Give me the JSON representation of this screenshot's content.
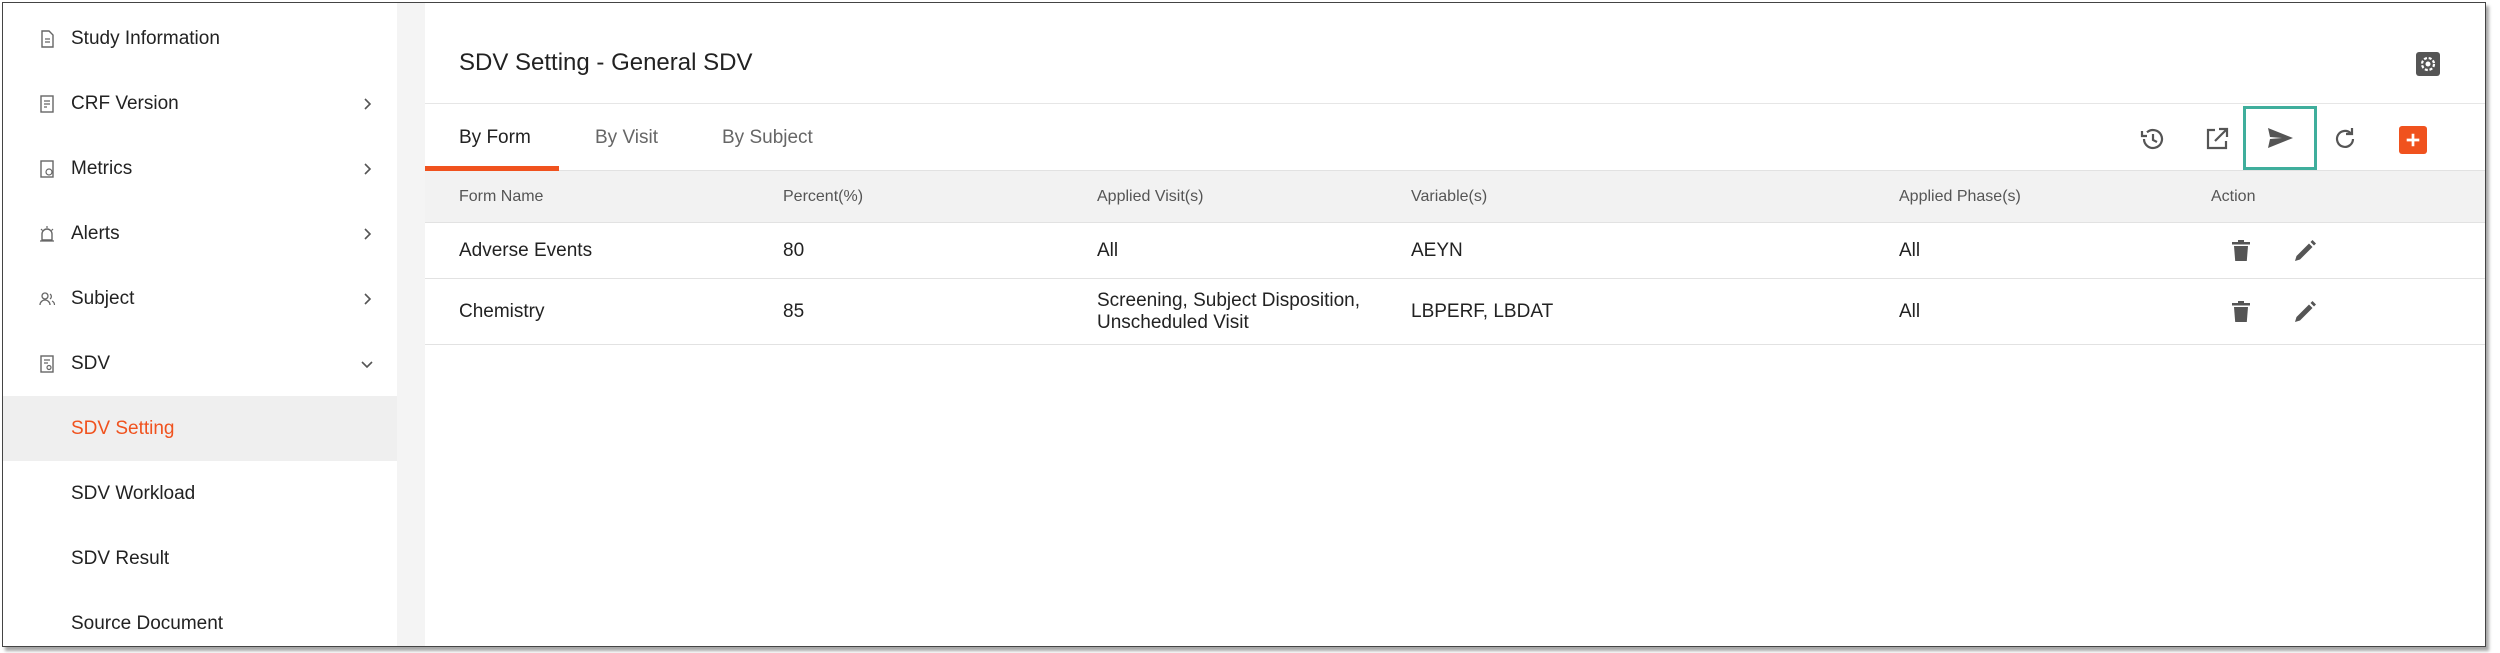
{
  "sidebar": {
    "items": [
      {
        "label": "Study Information",
        "icon": "document-icon",
        "chevron": "none"
      },
      {
        "label": "CRF Version",
        "icon": "form-icon",
        "chevron": "right"
      },
      {
        "label": "Metrics",
        "icon": "metrics-icon",
        "chevron": "right"
      },
      {
        "label": "Alerts",
        "icon": "alarm-icon",
        "chevron": "right"
      },
      {
        "label": "Subject",
        "icon": "people-icon",
        "chevron": "right"
      },
      {
        "label": "SDV",
        "icon": "sdv-icon",
        "chevron": "down"
      },
      {
        "label": "SDV Setting",
        "active": true
      },
      {
        "label": "SDV Workload"
      },
      {
        "label": "SDV Result"
      },
      {
        "label": "Source Document"
      }
    ]
  },
  "main": {
    "title": "SDV Setting - General SDV",
    "tabs": [
      {
        "label": "By Form",
        "active": true
      },
      {
        "label": "By Visit"
      },
      {
        "label": "By Subject"
      }
    ],
    "toolbar": [
      "history-icon",
      "open-external-icon",
      "send-icon",
      "refresh-icon",
      "add-icon"
    ],
    "table": {
      "headers": [
        "Form Name",
        "Percent(%)",
        "Applied Visit(s)",
        "Variable(s)",
        "Applied Phase(s)",
        "Action"
      ],
      "rows": [
        {
          "form": "Adverse Events",
          "percent": "80",
          "visits": "All",
          "variables": "AEYN",
          "phases": "All"
        },
        {
          "form": "Chemistry",
          "percent": "85",
          "visits": "Screening, Subject Disposition,\nUnscheduled Visit",
          "variables": "LBPERF, LBDAT",
          "phases": "All"
        }
      ]
    }
  },
  "colors": {
    "accent": "#f0521e",
    "highlight": "#3fae9c",
    "header_bg": "#f2f2f2",
    "active_bg": "#efefef"
  }
}
